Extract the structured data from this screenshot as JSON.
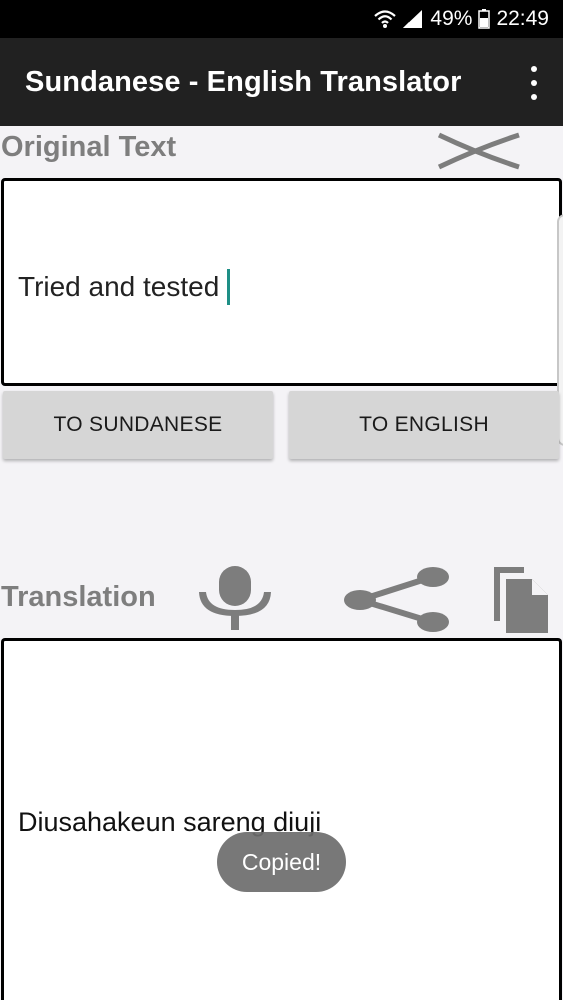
{
  "status_bar": {
    "battery_percent": "49%",
    "time": "22:49",
    "icons": [
      "wifi-icon",
      "signal-icon",
      "battery-icon"
    ]
  },
  "app_bar": {
    "title": "Sundanese - English Translator",
    "menu_icon": "overflow-menu-icon"
  },
  "original": {
    "label": "Original Text",
    "text": "Tried and tested",
    "clear_icon": "clear-icon"
  },
  "buttons": {
    "to_sundanese": "TO SUNDANESE",
    "to_english": "TO ENGLISH"
  },
  "translation": {
    "label": "Translation",
    "text": "Diusahakeun sareng diuji",
    "icons": [
      "microphone-icon",
      "share-icon",
      "copy-icon"
    ]
  },
  "toast": {
    "message": "Copied!"
  },
  "colors": {
    "app_bar": "#212121",
    "status_bar": "#000000",
    "background": "#f4f3f6",
    "label": "#7e7e7e",
    "button": "#d6d6d6",
    "icon": "#7d7d7d",
    "caret": "#1e8f86",
    "toast": "#6c6c6c"
  }
}
